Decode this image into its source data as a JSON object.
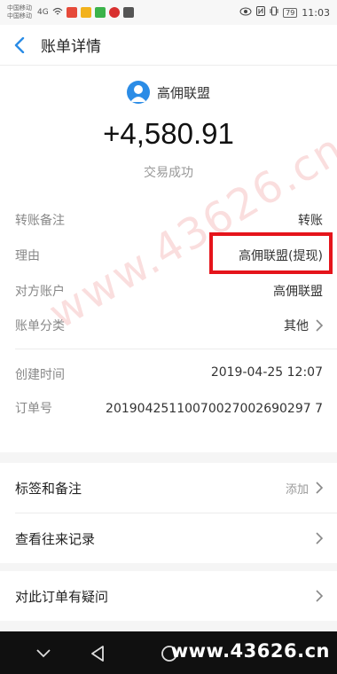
{
  "status_bar": {
    "carrier_1": "中国移动",
    "carrier_2": "中国移动",
    "network": "4G",
    "battery": "79",
    "time": "11:03"
  },
  "header": {
    "title": "账单详情"
  },
  "summary": {
    "merchant": "高佣联盟",
    "amount": "+4,580.91",
    "status": "交易成功"
  },
  "details": {
    "transfer_note_label": "转账备注",
    "transfer_note_value": "转账",
    "reason_label": "理由",
    "reason_value": "高佣联盟(提现)",
    "counterparty_label": "对方账户",
    "counterparty_value": "高佣联盟",
    "category_label": "账单分类",
    "category_value": "其他",
    "created_label": "创建时间",
    "created_value": "2019-04-25 12:07",
    "order_label": "订单号",
    "order_value": "20190425110070027002690297 7"
  },
  "actions": {
    "tags_label": "标签和备注",
    "tags_hint": "添加",
    "history_label": "查看往来记录",
    "question_label": "对此订单有疑问"
  },
  "watermark": "www.43626.cn",
  "site_logo": "www.43626.cn",
  "colors": {
    "accent": "#2b8ce6",
    "highlight": "#e5141b"
  }
}
